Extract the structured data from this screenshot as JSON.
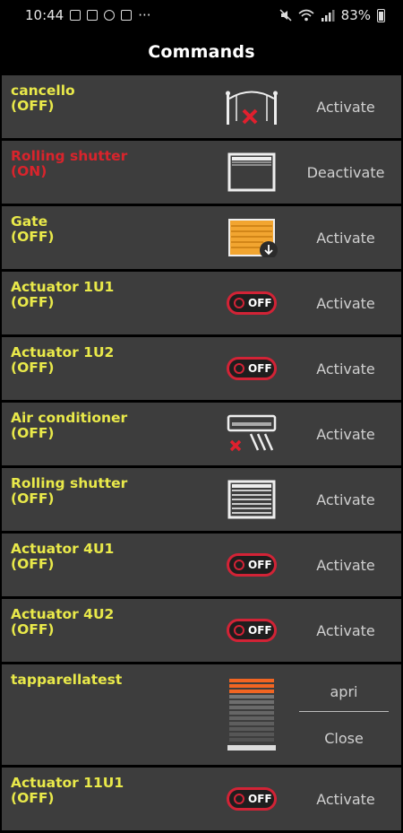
{
  "status_bar": {
    "time": "10:44",
    "more": "···",
    "battery": "83%",
    "icons_left": [
      "image-icon",
      "photo-icon",
      "clock-icon",
      "gallery-icon"
    ],
    "icons_right": [
      "mute-icon",
      "wifi-icon",
      "signal-icon",
      "battery-icon"
    ]
  },
  "app_bar": {
    "title": "Commands"
  },
  "commands": [
    {
      "name": "cancello",
      "state": "(OFF)",
      "action": "Activate",
      "icon": "gate-closed-icon"
    },
    {
      "name": "Rolling shutter",
      "state": "(ON)",
      "action": "Deactivate",
      "icon": "shutter-icon"
    },
    {
      "name": "Gate",
      "state": "(OFF)",
      "action": "Activate",
      "icon": "garage-door-icon"
    },
    {
      "name": "Actuator 1U1",
      "state": "(OFF)",
      "action": "Activate",
      "icon": "toggle-off-icon"
    },
    {
      "name": "Actuator 1U2",
      "state": "(OFF)",
      "action": "Activate",
      "icon": "toggle-off-icon"
    },
    {
      "name": "Air conditioner",
      "state": "(OFF)",
      "action": "Activate",
      "icon": "air-conditioner-icon"
    },
    {
      "name": "Rolling shutter",
      "state": "(OFF)",
      "action": "Activate",
      "icon": "shutter-icon"
    },
    {
      "name": "Actuator 4U1",
      "state": "(OFF)",
      "action": "Activate",
      "icon": "toggle-off-icon"
    },
    {
      "name": "Actuator 4U2",
      "state": "(OFF)",
      "action": "Activate",
      "icon": "toggle-off-icon"
    },
    {
      "name": "tapparellatest",
      "state": "",
      "action_top": "apri",
      "action_bottom": "Close",
      "icon": "blind-level-icon"
    },
    {
      "name": "Actuator 11U1",
      "state": "(OFF)",
      "action": "Activate",
      "icon": "toggle-off-icon"
    }
  ],
  "toggle_text": "OFF",
  "colors": {
    "background": "#000000",
    "row": "#3d3d3d",
    "label_off": "#e9e94a",
    "label_on": "#d8242c",
    "toggle_red": "#d22336",
    "blind_orange": "#f26522"
  }
}
